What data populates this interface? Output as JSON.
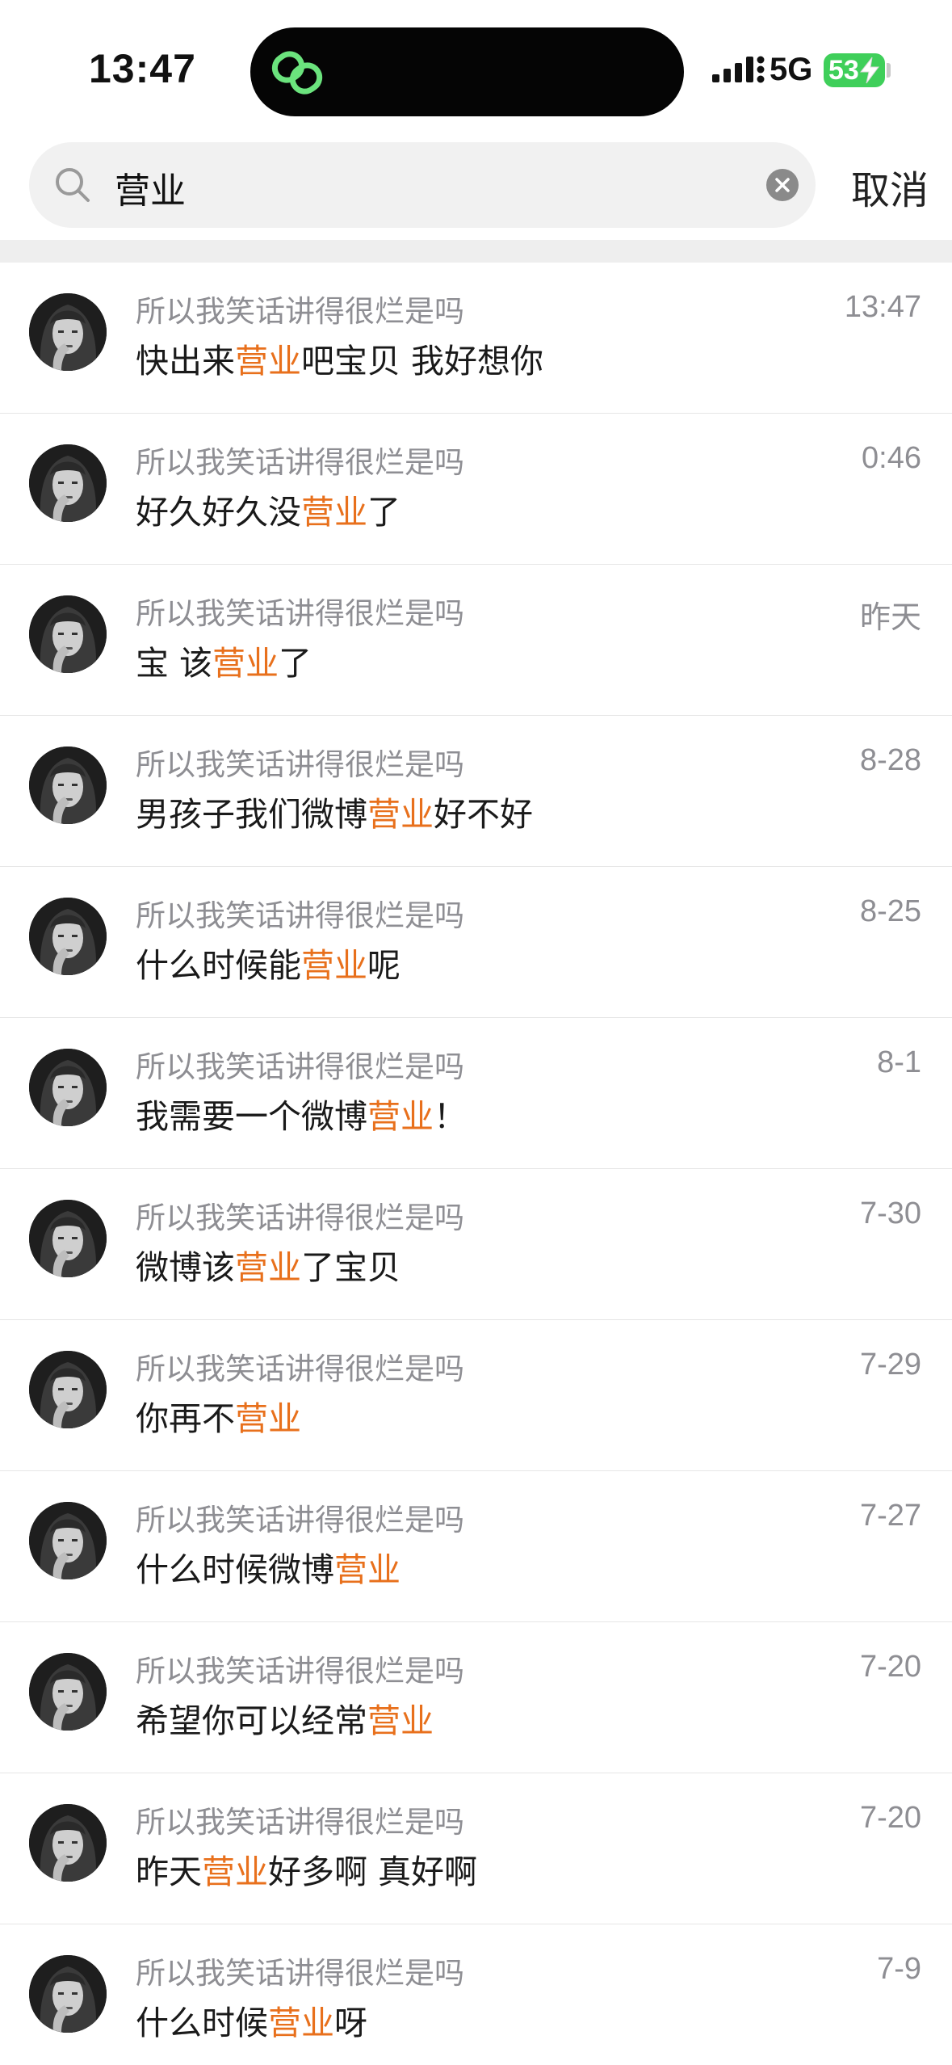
{
  "status_bar": {
    "time": "13:47",
    "network": "5G",
    "battery": "53"
  },
  "search": {
    "query": "营业",
    "cancel_label": "取消"
  },
  "colors": {
    "highlight": "#e8701c",
    "battery": "#3fcf5a",
    "island_icon": "#6be37d"
  },
  "results": [
    {
      "name": "所以我笑话讲得很烂是吗",
      "pre": "快出来",
      "hl": "营业",
      "post": "吧宝贝 我好想你",
      "date": "13:47"
    },
    {
      "name": "所以我笑话讲得很烂是吗",
      "pre": "好久好久没",
      "hl": "营业",
      "post": "了",
      "date": "0:46"
    },
    {
      "name": "所以我笑话讲得很烂是吗",
      "pre": "宝 该",
      "hl": "营业",
      "post": "了",
      "date": "昨天"
    },
    {
      "name": "所以我笑话讲得很烂是吗",
      "pre": "男孩子我们微博",
      "hl": "营业",
      "post": "好不好",
      "date": "8-28"
    },
    {
      "name": "所以我笑话讲得很烂是吗",
      "pre": "什么时候能",
      "hl": "营业",
      "post": "呢",
      "date": "8-25"
    },
    {
      "name": "所以我笑话讲得很烂是吗",
      "pre": "我需要一个微博",
      "hl": "营业",
      "post": "！",
      "date": "8-1"
    },
    {
      "name": "所以我笑话讲得很烂是吗",
      "pre": "微博该",
      "hl": "营业",
      "post": "了宝贝",
      "date": "7-30"
    },
    {
      "name": "所以我笑话讲得很烂是吗",
      "pre": "你再不",
      "hl": "营业",
      "post": "",
      "date": "7-29"
    },
    {
      "name": "所以我笑话讲得很烂是吗",
      "pre": "什么时候微博",
      "hl": "营业",
      "post": "",
      "date": "7-27"
    },
    {
      "name": "所以我笑话讲得很烂是吗",
      "pre": "希望你可以经常",
      "hl": "营业",
      "post": "",
      "date": "7-20"
    },
    {
      "name": "所以我笑话讲得很烂是吗",
      "pre": "昨天",
      "hl": "营业",
      "post": "好多啊 真好啊",
      "date": "7-20"
    },
    {
      "name": "所以我笑话讲得很烂是吗",
      "pre": "什么时候",
      "hl": "营业",
      "post": "呀",
      "date": "7-9"
    }
  ]
}
